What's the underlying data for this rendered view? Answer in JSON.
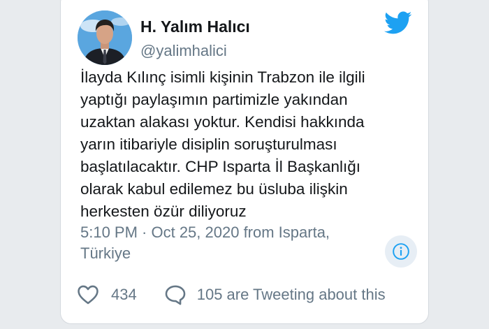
{
  "tweet": {
    "display_name": "H. Yalım Halıcı",
    "handle": "@yalimhalici",
    "text_lines": [
      "İlayda Kılınç isimli kişinin Trabzon ile ilgili",
      "yaptığı paylaşımın partimizle yakından",
      "uzaktan alakası yoktur. Kendisi hakkında",
      "yarın itibariyle disiplin soruşturulması",
      "başlatılacaktır. CHP Isparta İl Başkanlığı",
      "olarak kabul edilemez bu üsluba ilişkin",
      "herkesten özür diliyoruz"
    ],
    "timestamp_line1": "5:10 PM · Oct 25, 2020 from Isparta,",
    "timestamp_line2": "Türkiye",
    "like_count": "434",
    "activity_text": "105 are Tweeting about this"
  },
  "icons": {
    "brand": "twitter-bird-icon",
    "info": "info-icon",
    "like": "heart-icon",
    "reply": "speech-bubble-icon"
  },
  "colors": {
    "twitter_blue": "#1da1f2",
    "text": "#14171a",
    "secondary_text": "#657786",
    "card_border": "#d4d9de",
    "background": "#e8ebee"
  }
}
